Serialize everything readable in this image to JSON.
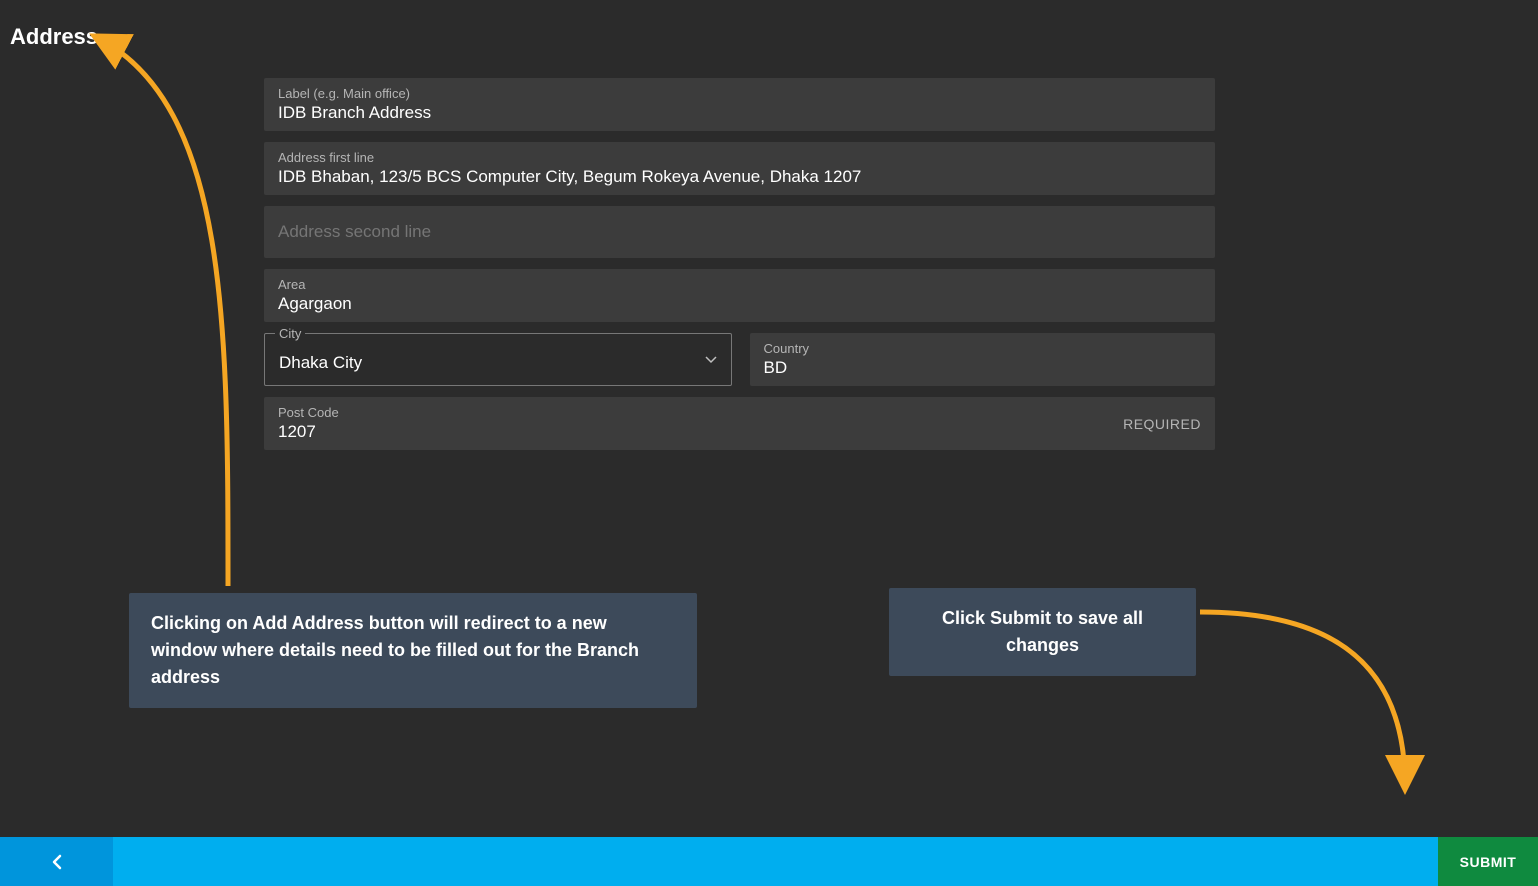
{
  "title": "Address",
  "form": {
    "label": {
      "caption": "Label (e.g. Main office)",
      "value": "IDB Branch Address"
    },
    "line1": {
      "caption": "Address first line",
      "value": "IDB Bhaban, 123/5 BCS Computer City, Begum Rokeya Avenue, Dhaka 1207"
    },
    "line2": {
      "placeholder": "Address second line",
      "value": ""
    },
    "area": {
      "caption": "Area",
      "value": "Agargaon"
    },
    "city": {
      "caption": "City",
      "value": "Dhaka City"
    },
    "country": {
      "caption": "Country",
      "value": "BD"
    },
    "postcode": {
      "caption": "Post Code",
      "value": "1207",
      "required_text": "REQUIRED"
    }
  },
  "callouts": {
    "add_address": "Clicking on Add Address button will redirect to a new window where details need to be filled out for the Branch address",
    "submit": "Click Submit to save all changes"
  },
  "footer": {
    "submit_label": "SUBMIT"
  }
}
